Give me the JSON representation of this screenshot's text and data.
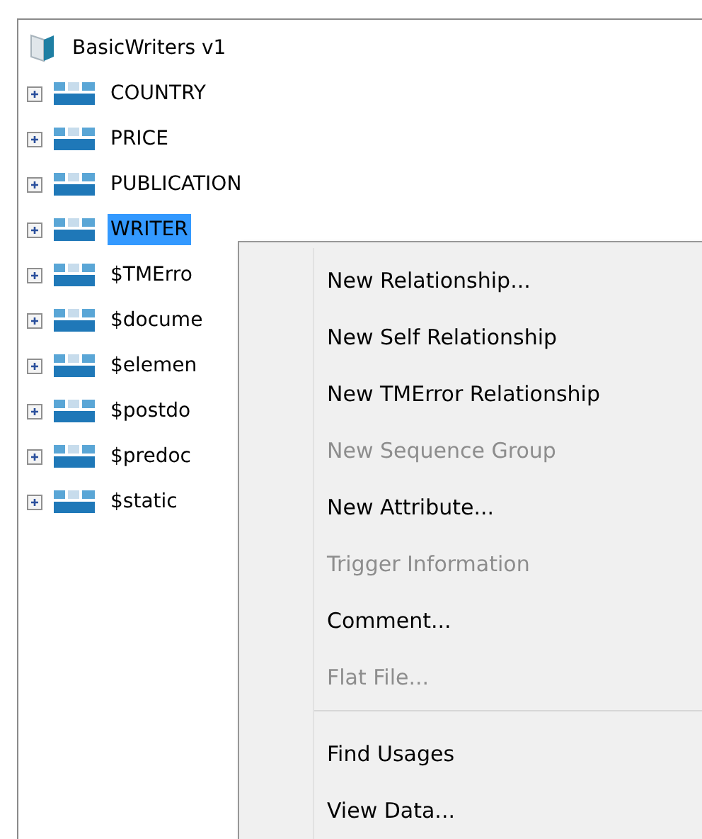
{
  "tree": {
    "root": {
      "label": "BasicWriters v1",
      "children": [
        {
          "label": "COUNTRY",
          "expanded": false,
          "selected": false
        },
        {
          "label": "PRICE",
          "expanded": false,
          "selected": false
        },
        {
          "label": "PUBLICATION",
          "expanded": false,
          "selected": false
        },
        {
          "label": "WRITER",
          "expanded": false,
          "selected": true
        },
        {
          "label": "$TMErro",
          "expanded": false,
          "selected": false
        },
        {
          "label": "$docume",
          "expanded": false,
          "selected": false
        },
        {
          "label": "$elemen",
          "expanded": false,
          "selected": false
        },
        {
          "label": "$postdo",
          "expanded": false,
          "selected": false
        },
        {
          "label": "$predoc",
          "expanded": false,
          "selected": false
        },
        {
          "label": "$static",
          "expanded": false,
          "selected": false
        }
      ]
    }
  },
  "context_menu": {
    "items": [
      {
        "kind": "item",
        "label": "New Relationship...",
        "disabled": false
      },
      {
        "kind": "item",
        "label": "New Self Relationship",
        "disabled": false
      },
      {
        "kind": "item",
        "label": "New TMError Relationship",
        "disabled": false
      },
      {
        "kind": "item",
        "label": "New Sequence Group",
        "disabled": true
      },
      {
        "kind": "item",
        "label": "New Attribute...",
        "disabled": false
      },
      {
        "kind": "item",
        "label": "Trigger Information",
        "disabled": true
      },
      {
        "kind": "item",
        "label": "Comment...",
        "disabled": false
      },
      {
        "kind": "item",
        "label": "Flat File...",
        "disabled": true
      },
      {
        "kind": "separator"
      },
      {
        "kind": "item",
        "label": "Find Usages",
        "disabled": false
      },
      {
        "kind": "item",
        "label": "View Data...",
        "disabled": false
      }
    ]
  }
}
